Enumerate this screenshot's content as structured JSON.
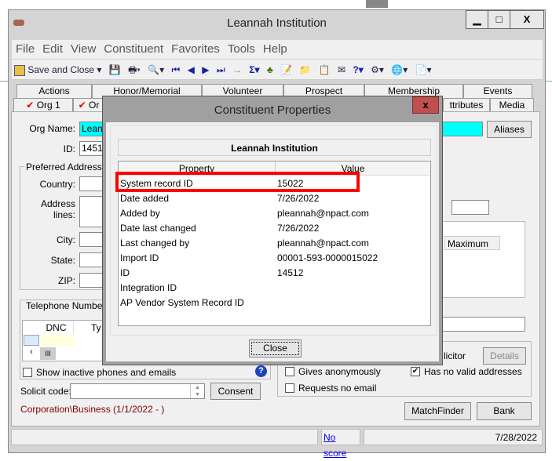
{
  "window": {
    "title": "Leannah Institution",
    "controls": [
      "▁",
      "□",
      "X"
    ]
  },
  "menu": [
    "File",
    "Edit",
    "View",
    "Constituent",
    "Favorites",
    "Tools",
    "Help"
  ],
  "toolbar": {
    "save_close": "Save and Close",
    "icons": [
      "save-icon",
      "print-icon",
      "preview-icon",
      "first-icon",
      "prev-icon",
      "next-icon",
      "last-icon",
      "goto-icon",
      "sum-icon",
      "tree-icon",
      "note-icon",
      "folder-icon",
      "edit-icon",
      "card-icon",
      "help-icon",
      "tools-icon",
      "web-icon",
      "document-icon"
    ]
  },
  "tabs_row1": [
    "Actions",
    "Honor/Memorial",
    "Volunteer",
    "Prospect",
    "Membership",
    "Events"
  ],
  "tabs_row2": [
    {
      "label": "Org 1",
      "check": "✔"
    },
    {
      "label": "Or",
      "check": "✔"
    },
    {
      "label": "ttributes"
    },
    {
      "label": "Media"
    }
  ],
  "form": {
    "org_name_label": "Org Name:",
    "org_name_value": "Leann",
    "id_label": "ID:",
    "id_value": "14512",
    "preferred_address": "Preferred Address - B",
    "country": "Country:",
    "address_lines": "Address lines:",
    "city": "City:",
    "state": "State:",
    "zip": "ZIP:",
    "aliases": "Aliases",
    "maximum": "Maximum",
    "telephone_numbers": "Telephone Numbers",
    "dnc": "DNC",
    "type": "Ty",
    "show_inactive": "Show inactive phones and emails",
    "solicit_code": "Solicit code:",
    "consent": "Consent",
    "org_type": "Corporation\\Business (1/1/2022 - )",
    "solicitor": "licitor",
    "details": "Details",
    "gives_anonymously": "Gives anonymously",
    "has_no_valid": "Has no valid addresses",
    "requests_no_email": "Requests no email",
    "matchfinder": "MatchFinder",
    "bank": "Bank"
  },
  "status": {
    "score": "No score",
    "date": "7/28/2022"
  },
  "dialog": {
    "title": "Constituent Properties",
    "close_x": "x",
    "heading": "Leannah Institution",
    "col_property": "Property",
    "col_value": "Value",
    "rows": [
      {
        "property": "System record ID",
        "value": "15022"
      },
      {
        "property": "Date added",
        "value": "7/26/2022"
      },
      {
        "property": "Added by",
        "value": "pleannah@npact.com"
      },
      {
        "property": "Date last changed",
        "value": "7/26/2022"
      },
      {
        "property": "Last changed by",
        "value": "pleannah@npact.com"
      },
      {
        "property": "Import ID",
        "value": "00001-593-0000015022"
      },
      {
        "property": "ID",
        "value": "14512"
      },
      {
        "property": "Integration ID",
        "value": ""
      },
      {
        "property": "AP Vendor System Record ID",
        "value": ""
      }
    ],
    "close_button": "Close",
    "highlight_color": "#ff0000"
  },
  "colors": {
    "org_name_bg": "#00ffff",
    "org_type_text": "#800000",
    "link": "#0000ee",
    "dialog_close": "#c0504d"
  }
}
